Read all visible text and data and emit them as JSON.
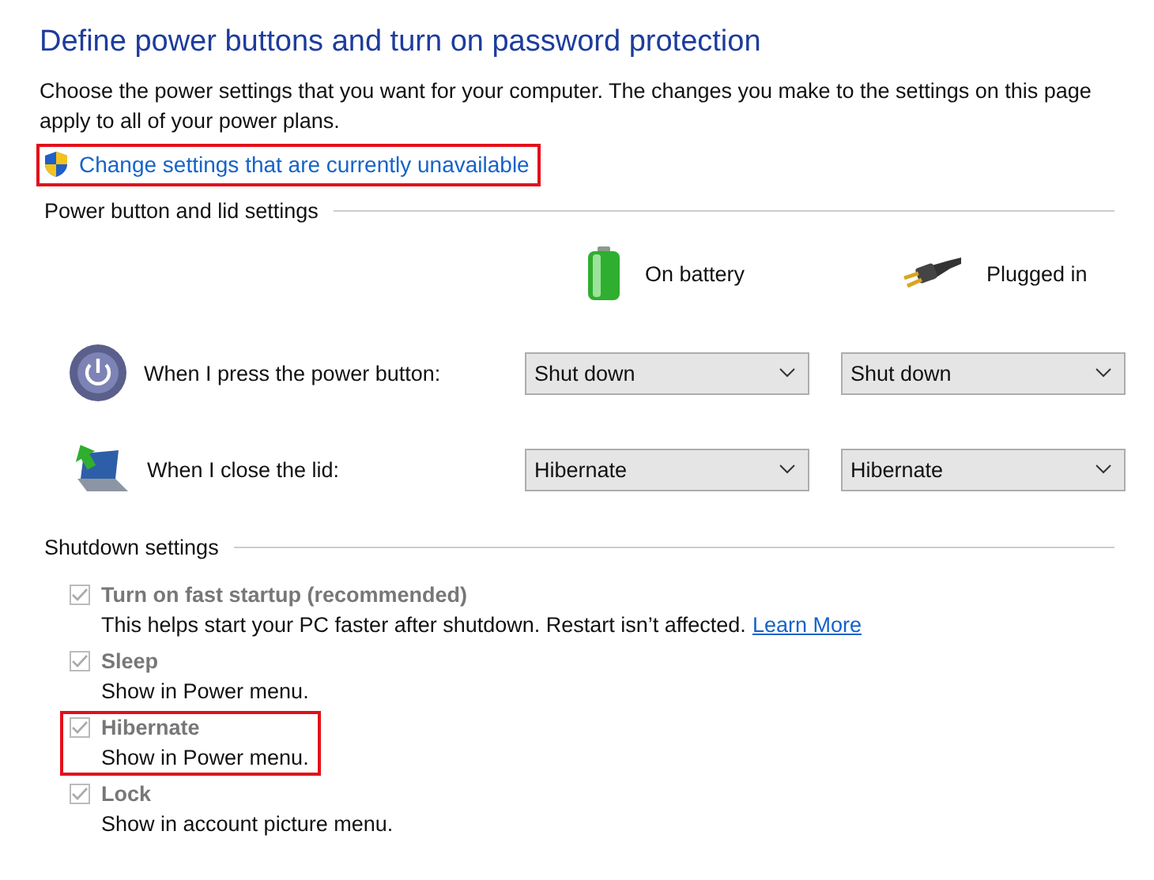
{
  "title": "Define power buttons and turn on password protection",
  "intro": "Choose the power settings that you want for your computer. The changes you make to the settings on this page apply to all of your power plans.",
  "admin_link": {
    "label": "Change settings that are currently unavailable",
    "highlighted": true
  },
  "power_section": {
    "heading": "Power button and lid settings",
    "columns": [
      {
        "label": "On battery",
        "kind": "battery"
      },
      {
        "label": "Plugged in",
        "kind": "plug"
      }
    ],
    "rows": [
      {
        "label": "When I press the power button:",
        "kind": "power",
        "values": [
          "Shut down",
          "Shut down"
        ]
      },
      {
        "label": "When I close the lid:",
        "kind": "lid",
        "values": [
          "Hibernate",
          "Hibernate"
        ]
      }
    ]
  },
  "shutdown_section": {
    "heading": "Shutdown settings",
    "options": [
      {
        "label": "Turn on fast startup (recommended)",
        "description": "This helps start your PC faster after shutdown. Restart isn’t affected.",
        "link": "Learn More",
        "checked": true,
        "disabled": true,
        "highlighted": false
      },
      {
        "label": "Sleep",
        "description": "Show in Power menu.",
        "checked": true,
        "disabled": true,
        "highlighted": false
      },
      {
        "label": "Hibernate",
        "description": "Show in Power menu.",
        "checked": true,
        "disabled": true,
        "highlighted": true
      },
      {
        "label": "Lock",
        "description": "Show in account picture menu.",
        "checked": true,
        "disabled": true,
        "highlighted": false
      }
    ]
  }
}
